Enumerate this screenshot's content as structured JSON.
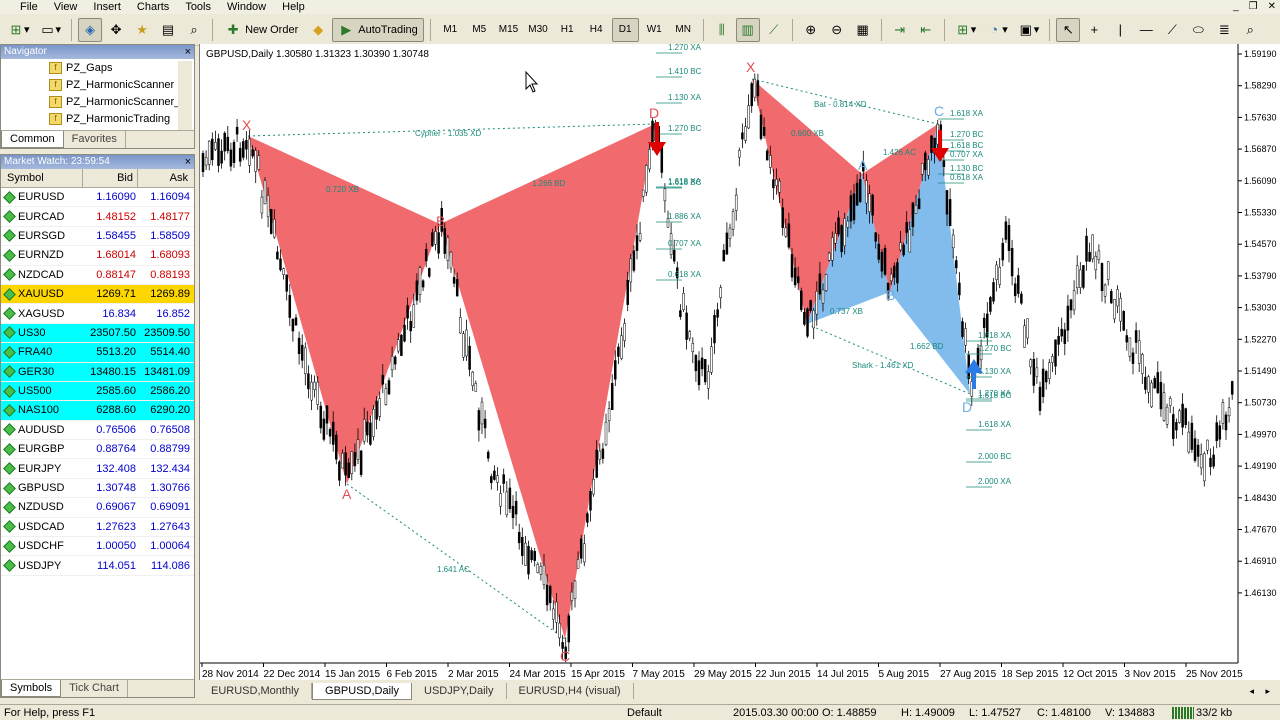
{
  "menu": [
    "File",
    "View",
    "Insert",
    "Charts",
    "Tools",
    "Window",
    "Help"
  ],
  "toolbar": {
    "new_order": "New Order",
    "auto_trading": "AutoTrading",
    "timeframes": [
      "M1",
      "M5",
      "M15",
      "M30",
      "H1",
      "H4",
      "D1",
      "W1",
      "MN"
    ],
    "active_timeframe": "D1"
  },
  "navigator": {
    "title": "Navigator",
    "items": [
      "PZ_Gaps",
      "PZ_HarmonicScanner",
      "PZ_HarmonicScanner_A",
      "PZ_HarmonicTrading"
    ],
    "tabs": [
      "Common",
      "Favorites"
    ]
  },
  "market_watch": {
    "title": "Market Watch: 23:59:54",
    "headers": [
      "Symbol",
      "Bid",
      "Ask"
    ],
    "rows": [
      {
        "symbol": "EURUSD",
        "bid": "1.16090",
        "ask": "1.16094",
        "color": "#0000cc",
        "bg": "#ffffff"
      },
      {
        "symbol": "EURCAD",
        "bid": "1.48152",
        "ask": "1.48177",
        "color": "#cc0000",
        "bg": "#ffffff"
      },
      {
        "symbol": "EURSGD",
        "bid": "1.58455",
        "ask": "1.58509",
        "color": "#0000cc",
        "bg": "#ffffff"
      },
      {
        "symbol": "EURNZD",
        "bid": "1.68014",
        "ask": "1.68093",
        "color": "#cc0000",
        "bg": "#ffffff"
      },
      {
        "symbol": "NZDCAD",
        "bid": "0.88147",
        "ask": "0.88193",
        "color": "#cc0000",
        "bg": "#ffffff"
      },
      {
        "symbol": "XAUUSD",
        "bid": "1269.71",
        "ask": "1269.89",
        "color": "#000000",
        "bg": "#ffd700"
      },
      {
        "symbol": "XAGUSD",
        "bid": "16.834",
        "ask": "16.852",
        "color": "#0000cc",
        "bg": "#ffffff"
      },
      {
        "symbol": "US30",
        "bid": "23507.50",
        "ask": "23509.50",
        "color": "#000000",
        "bg": "#00ffff"
      },
      {
        "symbol": "FRA40",
        "bid": "5513.20",
        "ask": "5514.40",
        "color": "#000000",
        "bg": "#00ffff"
      },
      {
        "symbol": "GER30",
        "bid": "13480.15",
        "ask": "13481.09",
        "color": "#000000",
        "bg": "#00ffff"
      },
      {
        "symbol": "US500",
        "bid": "2585.60",
        "ask": "2586.20",
        "color": "#000000",
        "bg": "#00ffff"
      },
      {
        "symbol": "NAS100",
        "bid": "6288.60",
        "ask": "6290.20",
        "color": "#000000",
        "bg": "#00ffff"
      },
      {
        "symbol": "AUDUSD",
        "bid": "0.76506",
        "ask": "0.76508",
        "color": "#0000cc",
        "bg": "#ffffff"
      },
      {
        "symbol": "EURGBP",
        "bid": "0.88764",
        "ask": "0.88799",
        "color": "#0000cc",
        "bg": "#ffffff"
      },
      {
        "symbol": "EURJPY",
        "bid": "132.408",
        "ask": "132.434",
        "color": "#0000cc",
        "bg": "#ffffff"
      },
      {
        "symbol": "GBPUSD",
        "bid": "1.30748",
        "ask": "1.30766",
        "color": "#0000cc",
        "bg": "#ffffff"
      },
      {
        "symbol": "NZDUSD",
        "bid": "0.69067",
        "ask": "0.69091",
        "color": "#0000cc",
        "bg": "#ffffff"
      },
      {
        "symbol": "USDCAD",
        "bid": "1.27623",
        "ask": "1.27643",
        "color": "#0000cc",
        "bg": "#ffffff"
      },
      {
        "symbol": "USDCHF",
        "bid": "1.00050",
        "ask": "1.00064",
        "color": "#0000cc",
        "bg": "#ffffff"
      },
      {
        "symbol": "USDJPY",
        "bid": "114.051",
        "ask": "114.086",
        "color": "#0000cc",
        "bg": "#ffffff"
      }
    ],
    "tabs": [
      "Symbols",
      "Tick Chart"
    ]
  },
  "chart": {
    "title": "GBPUSD,Daily  1.30580 1.31323 1.30390 1.30748",
    "price_labels": [
      "1.59190",
      "1.58290",
      "1.57630",
      "1.56870",
      "1.56090",
      "1.55330",
      "1.54570",
      "1.53790",
      "1.53030",
      "1.52270",
      "1.51490",
      "1.50730",
      "1.49970",
      "1.49190",
      "1.48430",
      "1.47670",
      "1.46910",
      "1.46130"
    ],
    "date_labels": [
      "28 Nov 2014",
      "22 Dec 2014",
      "15 Jan 2015",
      "6 Feb 2015",
      "2 Mar 2015",
      "24 Mar 2015",
      "15 Apr 2015",
      "7 May 2015",
      "29 May 2015",
      "22 Jun 2015",
      "14 Jul 2015",
      "5 Aug 2015",
      "27 Aug 2015",
      "18 Sep 2015",
      "12 Oct 2015",
      "3 Nov 2015",
      "25 Nov 2015"
    ],
    "pattern_points": [
      "X",
      "A",
      "B",
      "C",
      "D",
      "X",
      "A",
      "B",
      "C",
      "D"
    ],
    "pattern_notes": {
      "cypher": "Cypher - 1.035 XD",
      "xb1": "0.720 XB",
      "bd1": "1.266 BD",
      "ac1": "1.641 AC",
      "bat": "Bat - 0.814 XD",
      "xb2": "0.600 XB",
      "xa2": "1.426 AC",
      "shark": "Shark - 1.461 XD",
      "xb3": "0.737 XB",
      "bd3": "1.662 BD"
    },
    "fib_levels_left": [
      "1.270 XA",
      "1.410 BC",
      "1.130 XA",
      "1.270 BC",
      "1.618 XA",
      "1.618 BC",
      "1.886 XA",
      "0.707 XA",
      "0.618 XA"
    ],
    "fib_levels_right": [
      "1.618 XA",
      "1.270 BC",
      "1.130 XA",
      "1.270 XA",
      "1.618 BC",
      "1.618 XA",
      "2.000 BC",
      "2.000 XA"
    ],
    "fib_levels_top": [
      "1.618 XA",
      "1.270 BC",
      "1.618 BC",
      "1.130 BC",
      "0.707 XA",
      "0.618 XA"
    ]
  },
  "chart_tabs": [
    "EURUSD,Monthly",
    "GBPUSD,Daily",
    "USDJPY,Daily",
    "EURUSD,H4 (visual)"
  ],
  "active_chart_tab": "GBPUSD,Daily",
  "status": {
    "help": "For Help, press F1",
    "profile": "Default",
    "datetime": "2015.03.30 00:00",
    "open": "O: 1.48859",
    "high": "H: 1.49009",
    "low": "L: 1.47527",
    "close": "C: 1.48100",
    "volume": "V: 134883",
    "traffic": "33/2 kb"
  },
  "colors": {
    "bear_pattern": "#f06266",
    "bull_pattern": "#7bb8ec",
    "candle": "#000000",
    "fib": "#1a8a7a"
  }
}
